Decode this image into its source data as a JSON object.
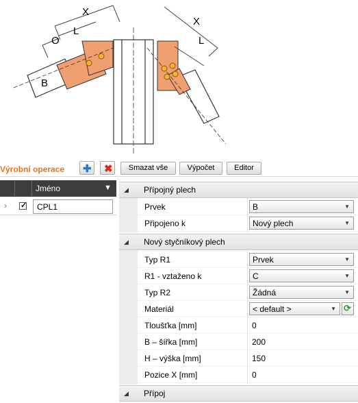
{
  "drawing": {
    "labels": {
      "x_left": "X",
      "l_left": "L",
      "o_left": "O",
      "b_left": "B",
      "x_right": "X",
      "l_right": "L"
    }
  },
  "toolbar": {
    "title": "Výrobní operace",
    "delete_all": "Smazat vše",
    "calculate": "Výpočet",
    "editor": "Editor"
  },
  "grid": {
    "column_name": "Jméno",
    "rows": [
      {
        "name": "CPL1",
        "checked": true
      }
    ]
  },
  "properties": {
    "sections": [
      {
        "title": "Přípojný plech",
        "rows": [
          {
            "label": "Prvek",
            "value": "B",
            "type": "dropdown"
          },
          {
            "label": "Připojeno k",
            "value": "Nový plech",
            "type": "dropdown"
          }
        ]
      },
      {
        "title": "Nový styčníkový plech",
        "rows": [
          {
            "label": "Typ R1",
            "value": "Prvek",
            "type": "dropdown"
          },
          {
            "label": "R1 - vztaženo k",
            "value": "C",
            "type": "dropdown"
          },
          {
            "label": "Typ R2",
            "value": "Žádná",
            "type": "dropdown"
          },
          {
            "label": "Materiál",
            "value": "< default >",
            "type": "dropdown"
          },
          {
            "label": "Tloušťka [mm]",
            "value": "0",
            "type": "text"
          },
          {
            "label": "B – šířka [mm]",
            "value": "200",
            "type": "text"
          },
          {
            "label": "H – výška [mm]",
            "value": "150",
            "type": "text"
          },
          {
            "label": "Pozice X [mm]",
            "value": "0",
            "type": "text"
          }
        ]
      },
      {
        "title": "Přípoj",
        "rows": []
      }
    ]
  },
  "colors": {
    "accent": "#e8741b",
    "plate": "#f0a070",
    "header": "#3d3d3d"
  }
}
